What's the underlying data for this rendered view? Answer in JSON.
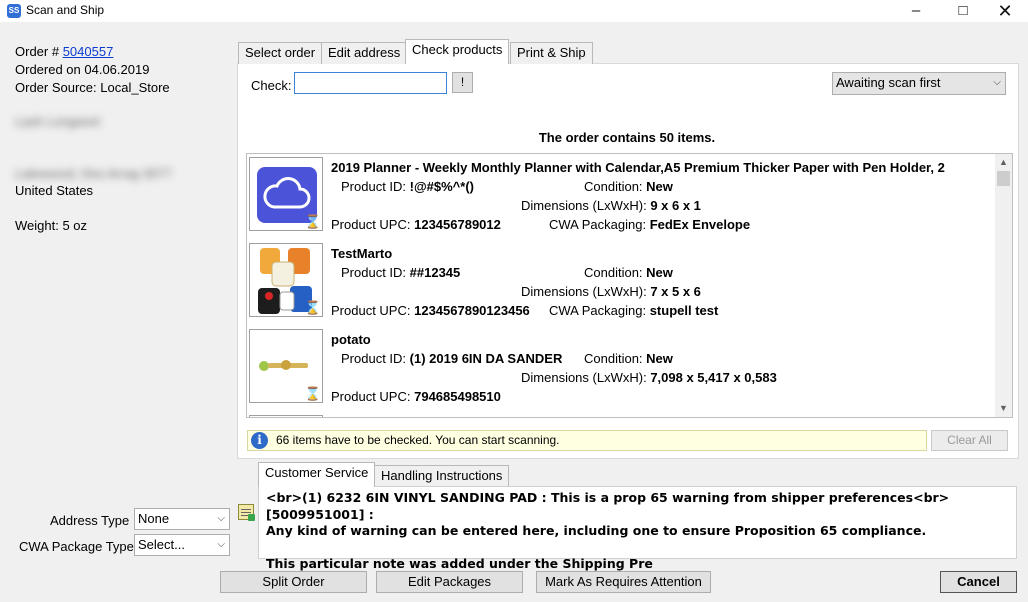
{
  "window": {
    "title": "Scan and Ship",
    "minimize_glyph": "–",
    "maximize_glyph": "□",
    "close_glyph": "✕"
  },
  "order": {
    "number_label": "Order #",
    "number": "5040557",
    "ordered_on": "Ordered on 04.06.2019",
    "source": "Order Source: Local_Store",
    "blurred_name": "Lash Longwort",
    "blurred_address": "Lakewood, Des Arrag 3077",
    "country": "United States",
    "weight": "Weight: 5 oz"
  },
  "shipping_options": {
    "address_type_label": "Address Type",
    "address_type_value": "None",
    "package_type_label": "CWA Package Type",
    "package_type_value": "Select..."
  },
  "tabs": [
    {
      "label": "Select order"
    },
    {
      "label": "Edit address"
    },
    {
      "label": "Check products"
    },
    {
      "label": "Print & Ship"
    }
  ],
  "check": {
    "label": "Check:",
    "value": "",
    "bang_label": "!",
    "mode_select": "Awaiting scan first"
  },
  "summary": "The order contains 50 items.",
  "labels": {
    "product_id": "Product ID:",
    "condition": "Condition:",
    "dimensions": "Dimensions (LxWxH):",
    "upc": "Product UPC:",
    "packaging": "CWA Packaging:"
  },
  "items": [
    {
      "title": "2019 Planner - Weekly  Monthly Planner with Calendar,A5 Premium Thicker Paper with Pen Holder, 2",
      "product_id": "!@#$%^*()",
      "condition": "New",
      "dimensions": "9 x 6 x 1",
      "upc": "123456789012",
      "packaging": "FedEx Envelope"
    },
    {
      "title": "TestMarto",
      "product_id": "##12345",
      "condition": "New",
      "dimensions": "7 x 5 x 6",
      "upc": "1234567890123456",
      "packaging": "stupell test"
    },
    {
      "title": "potato",
      "product_id": "(1) 2019 6IN DA SANDER",
      "condition": "New",
      "dimensions": "7,098 x 5,417 x 0,583",
      "upc": "794685498510",
      "packaging": ""
    }
  ],
  "info_message": "66 items have to be checked. You can start scanning.",
  "clear_all_label": "Clear All",
  "notes_tabs": [
    {
      "label": "Customer Service"
    },
    {
      "label": "Handling Instructions"
    }
  ],
  "notes_text": "<br>(1) 6232 6IN VINYL SANDING PAD : This is a prop 65 warning from shipper preferences<br>[5009951001] :\nAny kind of warning can be entered here, including one to ensure Proposition 65 compliance.\n\nThis particular note was added under the Shipping Pre",
  "buttons": {
    "split_order": "Split Order",
    "edit_packages": "Edit Packages",
    "mark_attention": "Mark As Requires Attention",
    "cancel": "Cancel"
  },
  "colors": {
    "link": "#0b3cd0",
    "info_bg": "#ffffe1",
    "focus_border": "#3c82d8",
    "cloud_tile": "#4b53d8"
  }
}
